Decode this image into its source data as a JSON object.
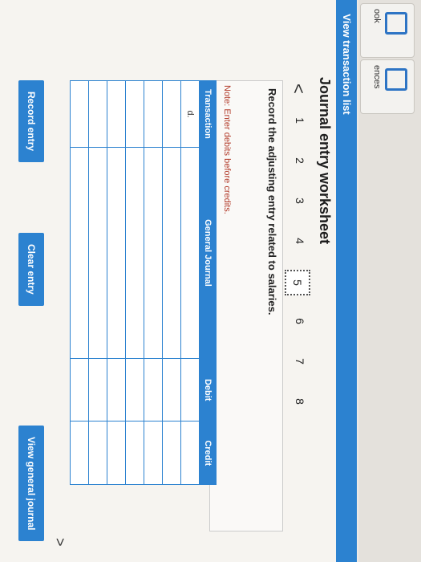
{
  "side_tabs": [
    {
      "label": "ook"
    },
    {
      "label": "ences"
    }
  ],
  "header": {
    "view_transaction_list": "View transaction list"
  },
  "worksheet": {
    "title": "Journal entry worksheet",
    "nav": {
      "prev_arrow": "<",
      "next_arrow": ">",
      "pages": [
        "1",
        "2",
        "3",
        "4",
        "5",
        "6",
        "7",
        "8"
      ],
      "active_page": "5"
    },
    "instruction": "Record the adjusting entry related to salaries.",
    "note": "Note: Enter debits before credits.",
    "table": {
      "headers": [
        "Transaction",
        "General Journal",
        "Debit",
        "Credit"
      ],
      "rows": [
        {
          "transaction": "d.",
          "account": "",
          "debit": "",
          "credit": ""
        },
        {
          "transaction": "",
          "account": "",
          "debit": "",
          "credit": ""
        },
        {
          "transaction": "",
          "account": "",
          "debit": "",
          "credit": ""
        },
        {
          "transaction": "",
          "account": "",
          "debit": "",
          "credit": ""
        },
        {
          "transaction": "",
          "account": "",
          "debit": "",
          "credit": ""
        },
        {
          "transaction": "",
          "account": "",
          "debit": "",
          "credit": ""
        },
        {
          "transaction": "",
          "account": "",
          "debit": "",
          "credit": ""
        }
      ]
    },
    "buttons": {
      "record": "Record entry",
      "clear": "Clear entry",
      "view_general": "View general journal"
    }
  }
}
